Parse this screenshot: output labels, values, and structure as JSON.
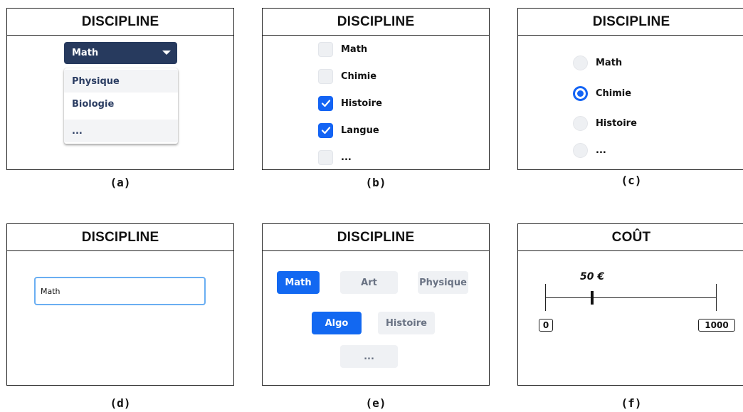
{
  "panel_a": {
    "title": "DISCIPLINE",
    "selected": "Math",
    "options": [
      "Physique",
      "Biologie",
      "..."
    ],
    "caption": "(a)"
  },
  "panel_b": {
    "title": "DISCIPLINE",
    "items": [
      {
        "label": "Math",
        "checked": false
      },
      {
        "label": "Chimie",
        "checked": false
      },
      {
        "label": "Histoire",
        "checked": true
      },
      {
        "label": "Langue",
        "checked": true
      },
      {
        "label": "...",
        "checked": false
      }
    ],
    "caption": "(b)"
  },
  "panel_c": {
    "title": "DISCIPLINE",
    "items": [
      {
        "label": "Math",
        "selected": false
      },
      {
        "label": "Chimie",
        "selected": true
      },
      {
        "label": "Histoire",
        "selected": false
      },
      {
        "label": "...",
        "selected": false
      }
    ],
    "caption": "(c)"
  },
  "panel_d": {
    "title": "DISCIPLINE",
    "input_value": "Math",
    "caption": "(d)"
  },
  "panel_e": {
    "title": "DISCIPLINE",
    "chips": [
      {
        "label": "Math",
        "selected": true
      },
      {
        "label": "Art",
        "selected": false
      },
      {
        "label": "Physique",
        "selected": false
      },
      {
        "label": "Algo",
        "selected": true
      },
      {
        "label": "Histoire",
        "selected": false
      },
      {
        "label": "...",
        "selected": false
      }
    ],
    "caption": "(e)"
  },
  "panel_f": {
    "title": "COÛT",
    "value_label": "50 €",
    "min_label": "0",
    "max_label": "1000",
    "caption": "(f)"
  },
  "colors": {
    "dropdown_bg": "#273a5e",
    "accent_blue": "#1464f4",
    "input_border": "#6aaef2",
    "chip_off_bg": "#eff1f4"
  }
}
